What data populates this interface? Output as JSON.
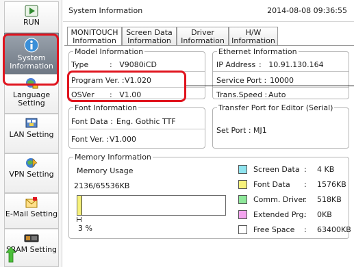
{
  "sidebar": {
    "items": [
      {
        "label": "RUN",
        "icon": "run-icon"
      },
      {
        "label": "System Information",
        "icon": "info-icon"
      },
      {
        "label": "Language Setting",
        "icon": "language-icon"
      },
      {
        "label": "LAN Setting",
        "icon": "lan-icon"
      },
      {
        "label": "VPN Setting",
        "icon": "vpn-icon"
      },
      {
        "label": "E-Mail Setting",
        "icon": "mail-icon"
      },
      {
        "label": "SRAM Setting",
        "icon": "sram-icon"
      }
    ]
  },
  "header": {
    "title": "System Information",
    "datetime": "2014-08-08 09:36:55"
  },
  "tabs": [
    {
      "line1": "MONITOUCH",
      "line2": "Information",
      "active": true
    },
    {
      "line1": "Screen Data",
      "line2": "Information",
      "active": false
    },
    {
      "line1": "Driver",
      "line2": "Information",
      "active": false
    },
    {
      "line1": "H/W",
      "line2": "Information",
      "active": false
    }
  ],
  "model_info": {
    "legend": "Model Information",
    "type_label": "Type",
    "type_value": ":   V9080iCD",
    "program_label": "Program Ver. :",
    "program_value": "V1.020",
    "os_label": "OSVer",
    "os_value": ":   V1.00"
  },
  "ethernet_info": {
    "legend": "Ethernet Information",
    "ip_label": "IP Address",
    "ip_value": ":   10.91.130.164",
    "port_label": "Service Port :",
    "port_value": "10000",
    "speed_label": "Trans.Speed :",
    "speed_value": "Auto"
  },
  "font_info": {
    "legend": "Font Information",
    "data_label": "Font Data :",
    "data_value": "Eng. Gothic TTF",
    "ver_label": "Font Ver. :",
    "ver_value": "V1.000"
  },
  "transfer_port": {
    "legend": "Transfer Port for Editor (Serial)",
    "set_label": "Set Port :",
    "set_value": "MJ1"
  },
  "memory": {
    "legend": "Memory Information",
    "usage_label": "Memory Usage",
    "usage_value": "2136/65536KB",
    "percent_label": "3 %",
    "used_fraction": 0.033,
    "legend_items": [
      {
        "name": "Screen Data",
        "value": "4 KB",
        "color": "#8fe4ef"
      },
      {
        "name": "Font Data",
        "value": "1576KB",
        "color": "#f7f27a"
      },
      {
        "name": "Comm. Driver",
        "value": "518KB",
        "color": "#8ee89a"
      },
      {
        "name": "Extended Prg.",
        "value": "0KB",
        "color": "#f4a3ef"
      },
      {
        "name": "Free Space",
        "value": "63400KB",
        "color": "#ffffff"
      }
    ],
    "colon": ":"
  },
  "colors": {
    "highlight": "#e0141e",
    "selected_sidebar": "#7c8591"
  }
}
